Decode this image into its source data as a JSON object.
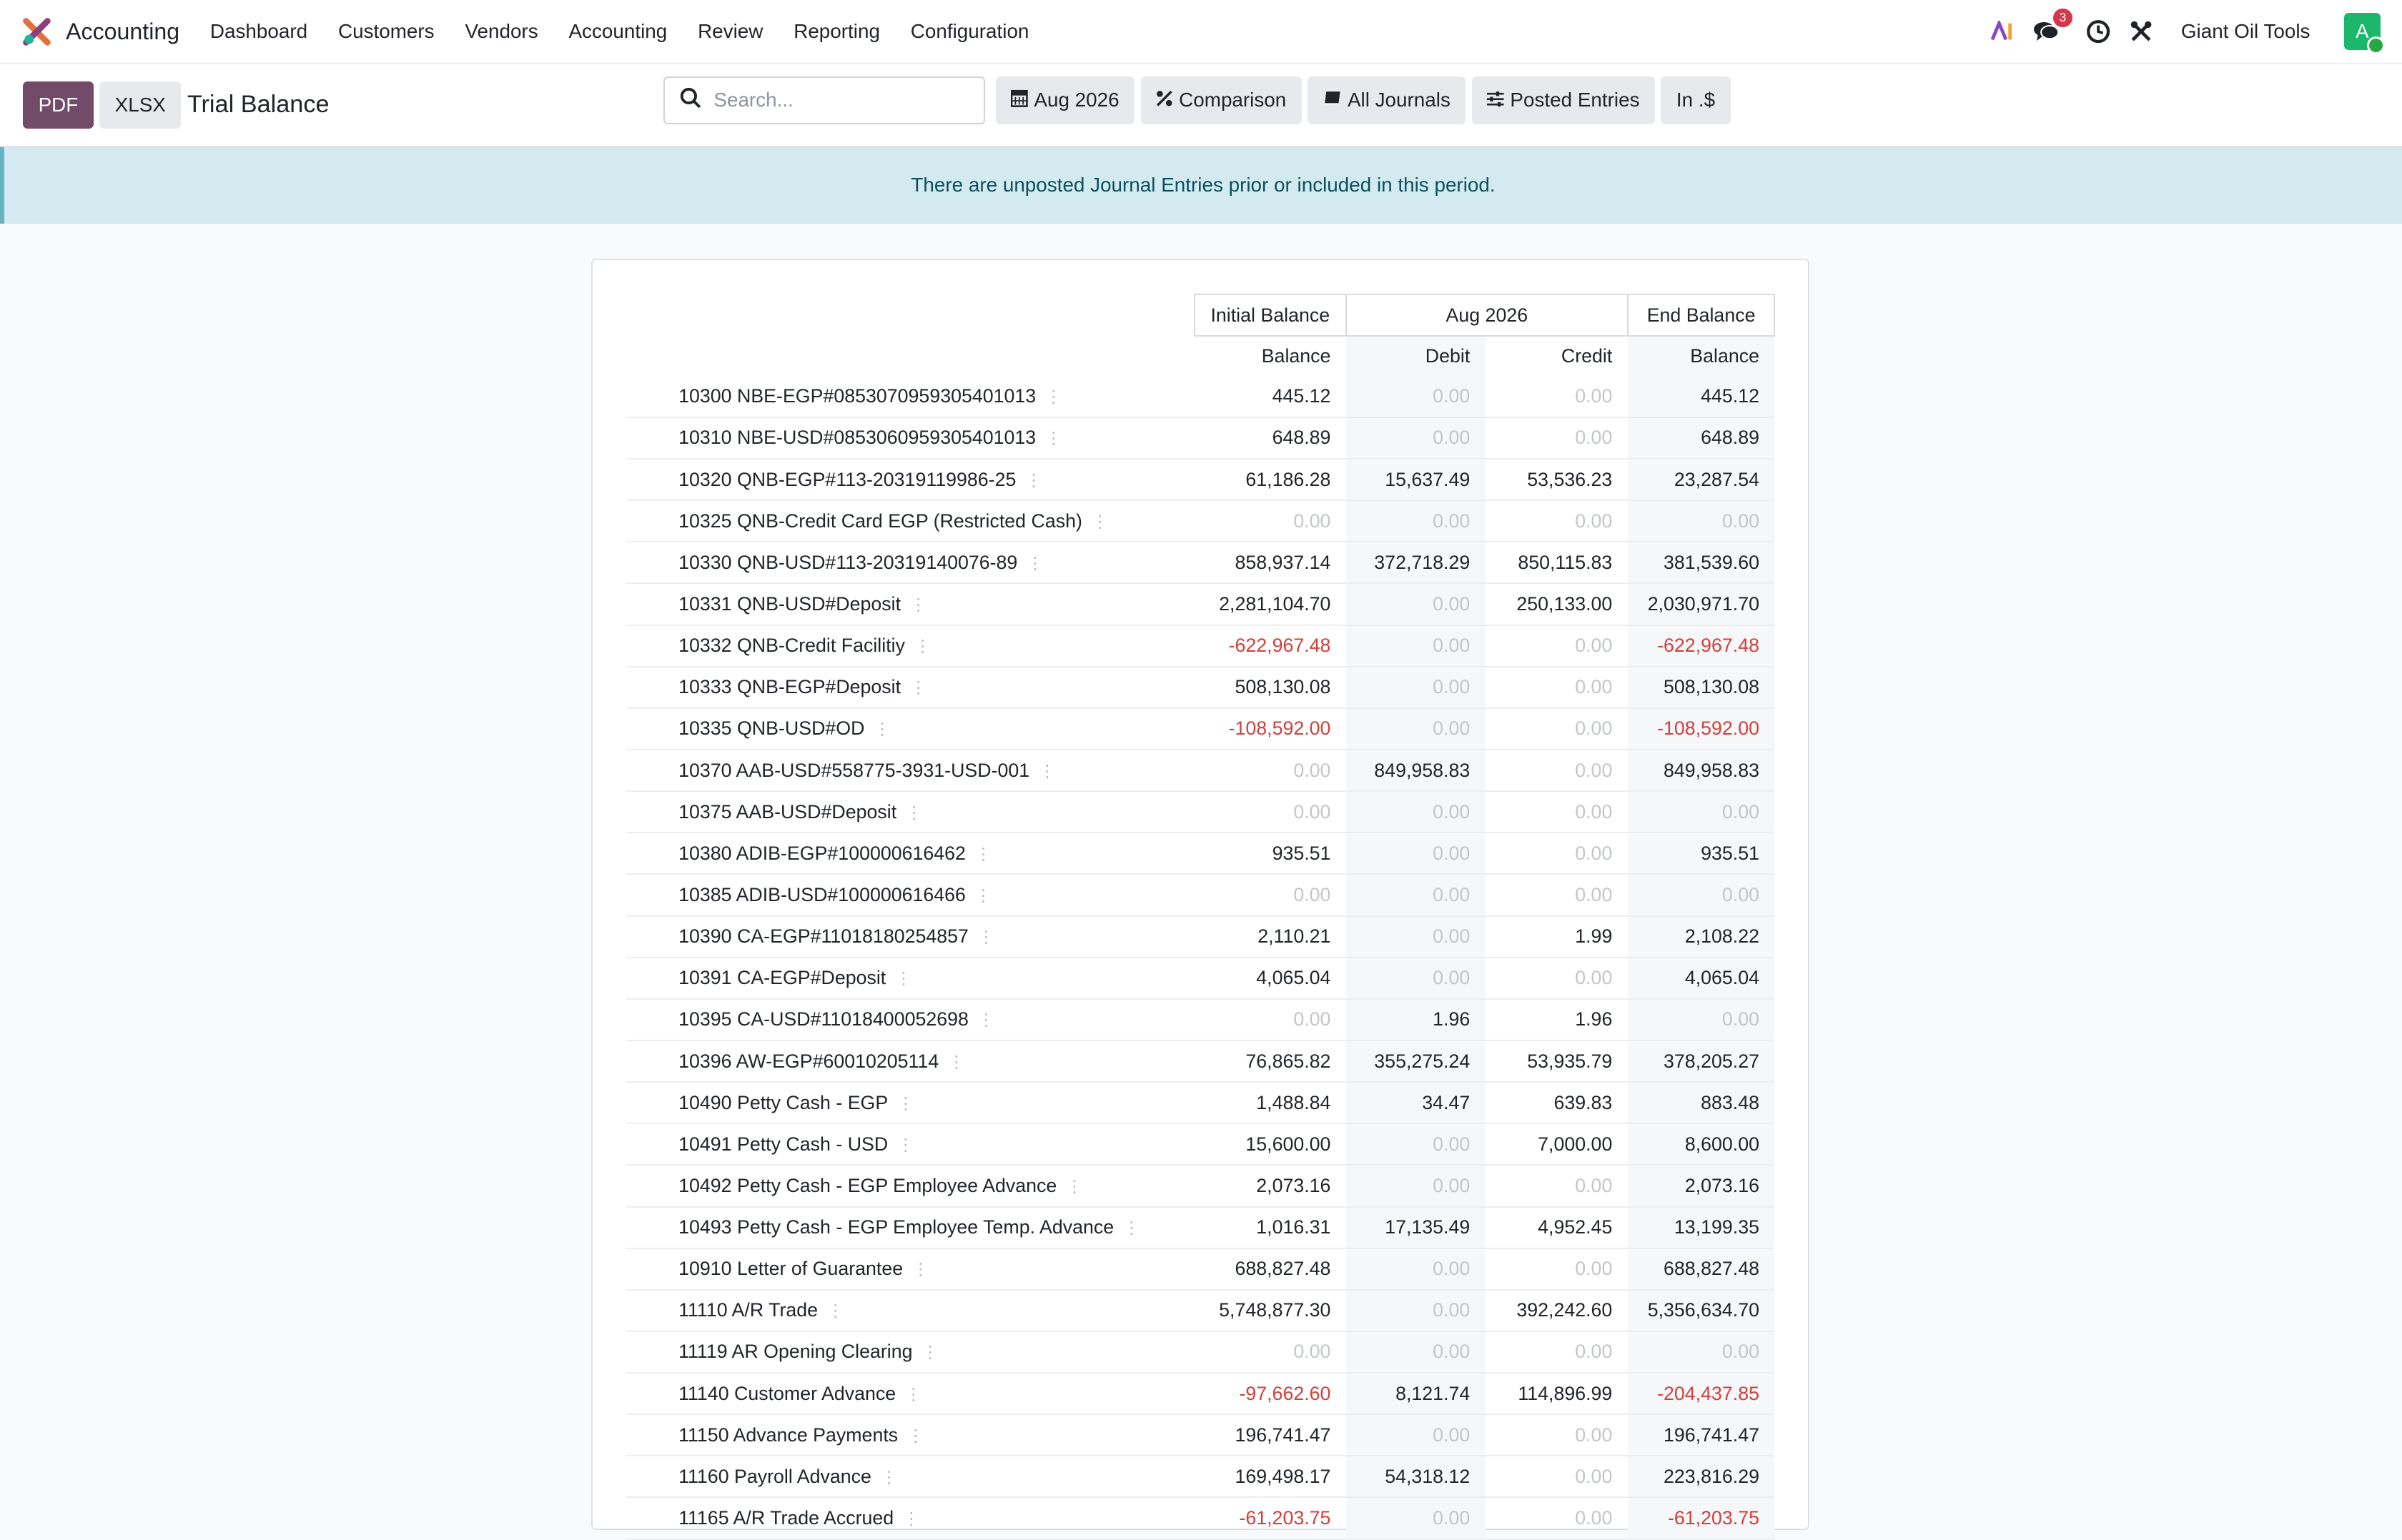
{
  "navbar": {
    "app_name": "Accounting",
    "menu": [
      "Dashboard",
      "Customers",
      "Vendors",
      "Accounting",
      "Review",
      "Reporting",
      "Configuration"
    ],
    "message_count": "3",
    "company": "Giant Oil Tools",
    "avatar_letter": "A"
  },
  "control_panel": {
    "pdf_label": "PDF",
    "xlsx_label": "XLSX",
    "title": "Trial Balance",
    "search_placeholder": "Search...",
    "filters": {
      "date": "Aug 2026",
      "comparison": "Comparison",
      "journals": "All Journals",
      "entries": "Posted Entries",
      "currency": "In .$"
    }
  },
  "alert": "There are unposted Journal Entries prior or included in this period.",
  "report": {
    "group_headers": {
      "initial": "Initial Balance",
      "period": "Aug 2026",
      "end": "End Balance"
    },
    "col_headers": {
      "initial_balance": "Balance",
      "debit": "Debit",
      "credit": "Credit",
      "end_balance": "Balance"
    },
    "rows": [
      {
        "account": "10300 NBE-EGP#0853070959305401013",
        "initial": "445.12",
        "debit": "0.00",
        "credit": "0.00",
        "end": "445.12"
      },
      {
        "account": "10310 NBE-USD#0853060959305401013",
        "initial": "648.89",
        "debit": "0.00",
        "credit": "0.00",
        "end": "648.89"
      },
      {
        "account": "10320 QNB-EGP#113-20319119986-25",
        "initial": "61,186.28",
        "debit": "15,637.49",
        "credit": "53,536.23",
        "end": "23,287.54"
      },
      {
        "account": "10325 QNB-Credit Card EGP (Restricted Cash)",
        "initial": "0.00",
        "debit": "0.00",
        "credit": "0.00",
        "end": "0.00"
      },
      {
        "account": "10330 QNB-USD#113-20319140076-89",
        "initial": "858,937.14",
        "debit": "372,718.29",
        "credit": "850,115.83",
        "end": "381,539.60"
      },
      {
        "account": "10331 QNB-USD#Deposit",
        "initial": "2,281,104.70",
        "debit": "0.00",
        "credit": "250,133.00",
        "end": "2,030,971.70"
      },
      {
        "account": "10332 QNB-Credit Facilitiy",
        "initial": "-622,967.48",
        "debit": "0.00",
        "credit": "0.00",
        "end": "-622,967.48"
      },
      {
        "account": "10333 QNB-EGP#Deposit",
        "initial": "508,130.08",
        "debit": "0.00",
        "credit": "0.00",
        "end": "508,130.08"
      },
      {
        "account": "10335 QNB-USD#OD",
        "initial": "-108,592.00",
        "debit": "0.00",
        "credit": "0.00",
        "end": "-108,592.00"
      },
      {
        "account": "10370 AAB-USD#558775-3931-USD-001",
        "initial": "0.00",
        "debit": "849,958.83",
        "credit": "0.00",
        "end": "849,958.83"
      },
      {
        "account": "10375 AAB-USD#Deposit",
        "initial": "0.00",
        "debit": "0.00",
        "credit": "0.00",
        "end": "0.00"
      },
      {
        "account": "10380 ADIB-EGP#100000616462",
        "initial": "935.51",
        "debit": "0.00",
        "credit": "0.00",
        "end": "935.51"
      },
      {
        "account": "10385 ADIB-USD#100000616466",
        "initial": "0.00",
        "debit": "0.00",
        "credit": "0.00",
        "end": "0.00"
      },
      {
        "account": "10390 CA-EGP#11018180254857",
        "initial": "2,110.21",
        "debit": "0.00",
        "credit": "1.99",
        "end": "2,108.22"
      },
      {
        "account": "10391 CA-EGP#Deposit",
        "initial": "4,065.04",
        "debit": "0.00",
        "credit": "0.00",
        "end": "4,065.04"
      },
      {
        "account": "10395 CA-USD#11018400052698",
        "initial": "0.00",
        "debit": "1.96",
        "credit": "1.96",
        "end": "0.00"
      },
      {
        "account": "10396 AW-EGP#60010205114",
        "initial": "76,865.82",
        "debit": "355,275.24",
        "credit": "53,935.79",
        "end": "378,205.27"
      },
      {
        "account": "10490 Petty Cash - EGP",
        "initial": "1,488.84",
        "debit": "34.47",
        "credit": "639.83",
        "end": "883.48"
      },
      {
        "account": "10491 Petty Cash - USD",
        "initial": "15,600.00",
        "debit": "0.00",
        "credit": "7,000.00",
        "end": "8,600.00"
      },
      {
        "account": "10492 Petty Cash - EGP Employee Advance",
        "initial": "2,073.16",
        "debit": "0.00",
        "credit": "0.00",
        "end": "2,073.16"
      },
      {
        "account": "10493 Petty Cash - EGP Employee Temp. Advance",
        "initial": "1,016.31",
        "debit": "17,135.49",
        "credit": "4,952.45",
        "end": "13,199.35"
      },
      {
        "account": "10910 Letter of Guarantee",
        "initial": "688,827.48",
        "debit": "0.00",
        "credit": "0.00",
        "end": "688,827.48"
      },
      {
        "account": "11110 A/R Trade",
        "initial": "5,748,877.30",
        "debit": "0.00",
        "credit": "392,242.60",
        "end": "5,356,634.70"
      },
      {
        "account": "11119 AR Opening Clearing",
        "initial": "0.00",
        "debit": "0.00",
        "credit": "0.00",
        "end": "0.00"
      },
      {
        "account": "11140 Customer Advance",
        "initial": "-97,662.60",
        "debit": "8,121.74",
        "credit": "114,896.99",
        "end": "-204,437.85"
      },
      {
        "account": "11150 Advance Payments",
        "initial": "196,741.47",
        "debit": "0.00",
        "credit": "0.00",
        "end": "196,741.47"
      },
      {
        "account": "11160 Payroll Advance",
        "initial": "169,498.17",
        "debit": "54,318.12",
        "credit": "0.00",
        "end": "223,816.29"
      },
      {
        "account": "11165 A/R Trade Accrued",
        "initial": "-61,203.75",
        "debit": "0.00",
        "credit": "0.00",
        "end": "-61,203.75"
      }
    ]
  }
}
